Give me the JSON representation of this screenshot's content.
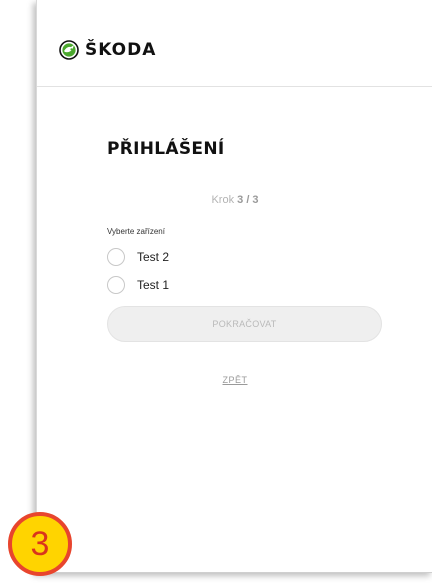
{
  "brand": {
    "name": "ŠKODA",
    "color": "#4ba82e"
  },
  "login": {
    "title": "PŘIHLÁŠENÍ",
    "step_prefix": "Krok",
    "step_value": "3 / 3",
    "field_label": "Vyberte zařízení",
    "options": [
      {
        "label": "Test 2",
        "selected": false
      },
      {
        "label": "Test 1",
        "selected": false
      }
    ],
    "continue_label": "POKRAČOVAT",
    "back_label": "ZPĚT"
  },
  "annotation": {
    "number": "3",
    "fill": "#ffd400",
    "border": "#e8452d"
  }
}
